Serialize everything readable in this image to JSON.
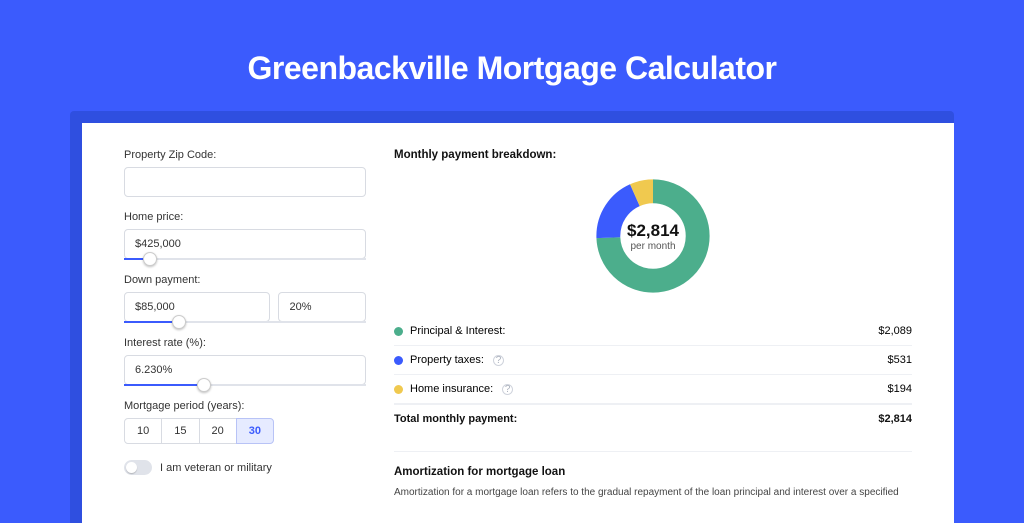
{
  "title": "Greenbackville Mortgage Calculator",
  "form": {
    "zip_label": "Property Zip Code:",
    "zip_value": "",
    "price_label": "Home price:",
    "price_value": "$425,000",
    "down_label": "Down payment:",
    "down_value": "$85,000",
    "down_pct": "20%",
    "rate_label": "Interest rate (%):",
    "rate_value": "6.230%",
    "period_label": "Mortgage period (years):",
    "periods": [
      "10",
      "15",
      "20",
      "30"
    ],
    "period_active": "30",
    "veteran_label": "I am veteran or military"
  },
  "breakdown": {
    "title": "Monthly payment breakdown:",
    "amount": "$2,814",
    "sub": "per month",
    "items": [
      {
        "label": "Principal & Interest:",
        "value": "$2,089",
        "info": false
      },
      {
        "label": "Property taxes:",
        "value": "$531",
        "info": true
      },
      {
        "label": "Home insurance:",
        "value": "$194",
        "info": true
      }
    ],
    "total_label": "Total monthly payment:",
    "total_value": "$2,814"
  },
  "amort": {
    "title": "Amortization for mortgage loan",
    "text": "Amortization for a mortgage loan refers to the gradual repayment of the loan principal and interest over a specified"
  },
  "chart_data": {
    "type": "pie",
    "title": "Monthly payment breakdown",
    "series": [
      {
        "name": "Principal & Interest",
        "value": 2089,
        "color": "#4cae8c"
      },
      {
        "name": "Property taxes",
        "value": 531,
        "color": "#3b5bfd"
      },
      {
        "name": "Home insurance",
        "value": 194,
        "color": "#f0c94f"
      }
    ],
    "total": 2814
  }
}
